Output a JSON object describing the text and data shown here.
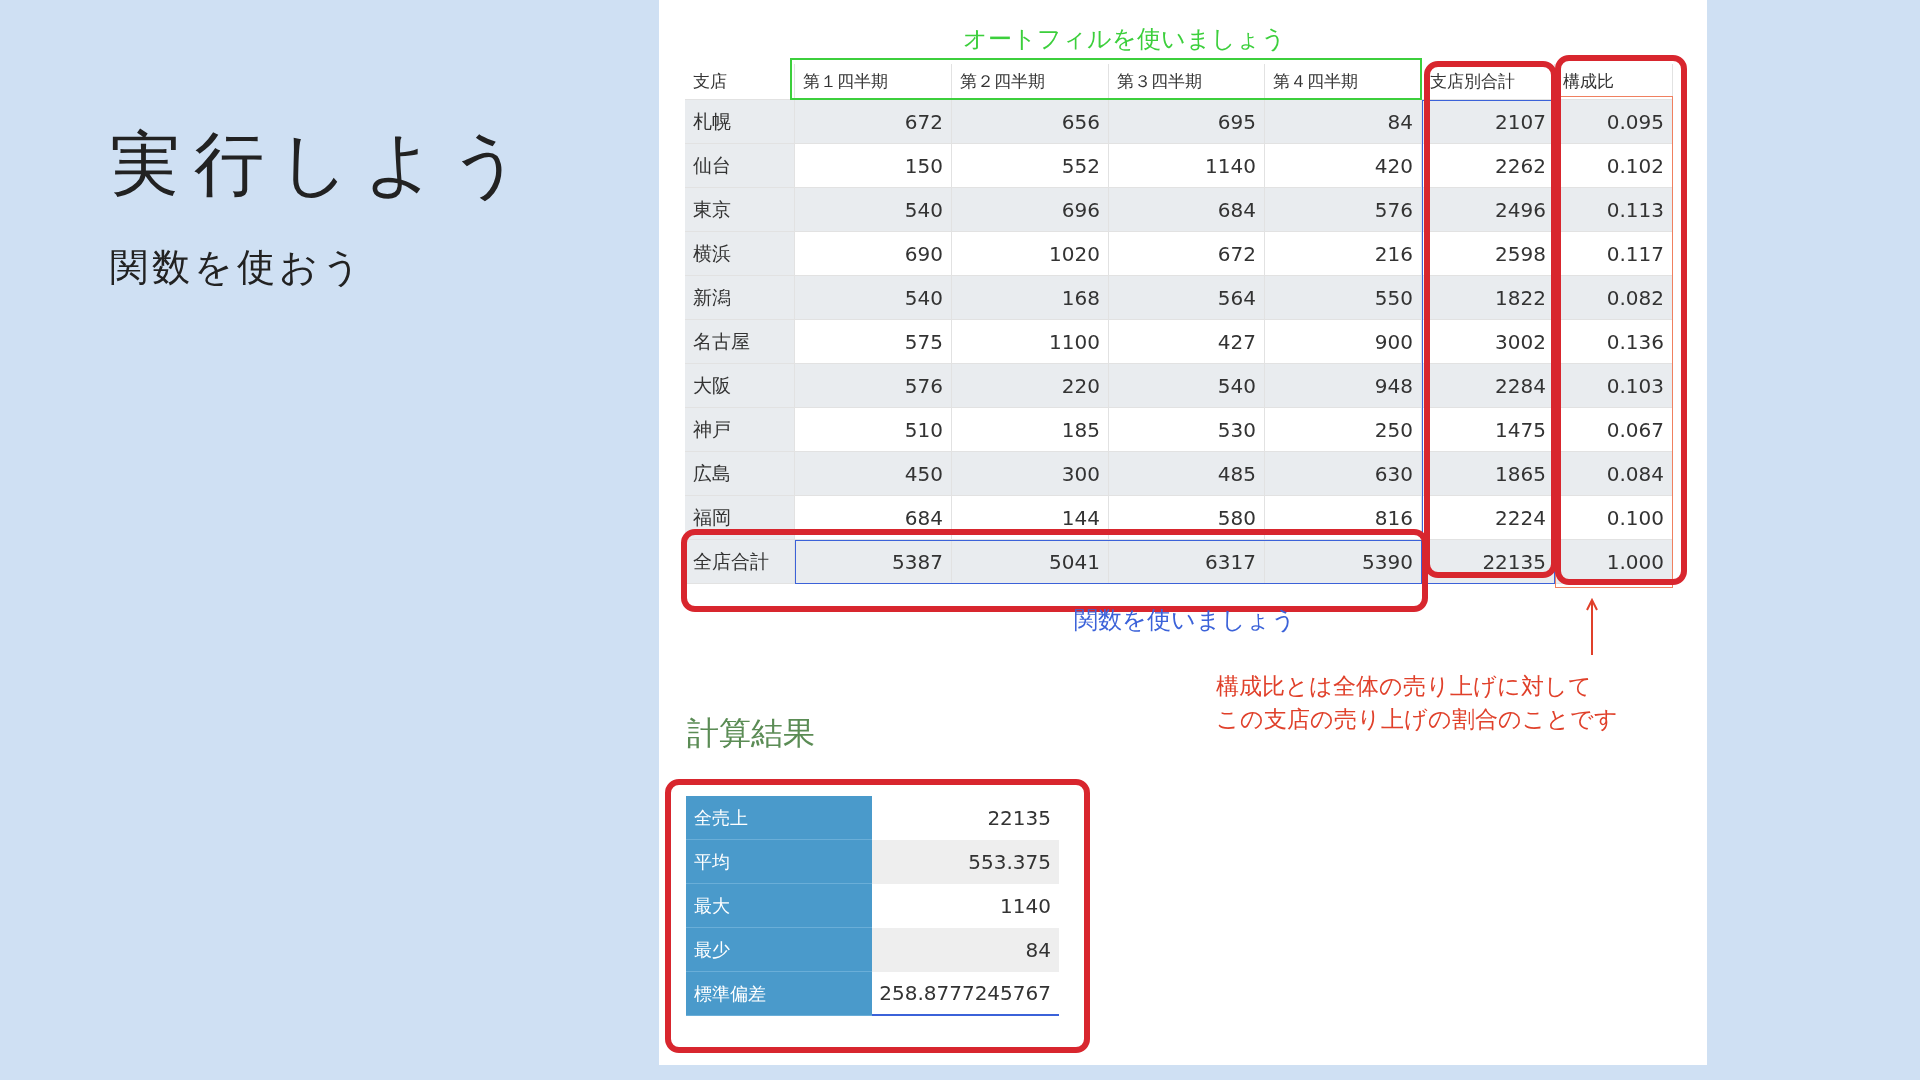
{
  "slide": {
    "title": "実行しよう",
    "subtitle": "関数を使おう"
  },
  "sheet": {
    "columns": [
      "支店",
      "第１四半期",
      "第２四半期",
      "第３四半期",
      "第４四半期",
      "支店別合計",
      "構成比"
    ],
    "rows": [
      {
        "branch": "札幌",
        "values": [
          "672",
          "656",
          "695",
          "84",
          "2107",
          "0.095"
        ]
      },
      {
        "branch": "仙台",
        "values": [
          "150",
          "552",
          "1140",
          "420",
          "2262",
          "0.102"
        ]
      },
      {
        "branch": "東京",
        "values": [
          "540",
          "696",
          "684",
          "576",
          "2496",
          "0.113"
        ]
      },
      {
        "branch": "横浜",
        "values": [
          "690",
          "1020",
          "672",
          "216",
          "2598",
          "0.117"
        ]
      },
      {
        "branch": "新潟",
        "values": [
          "540",
          "168",
          "564",
          "550",
          "1822",
          "0.082"
        ]
      },
      {
        "branch": "名古屋",
        "values": [
          "575",
          "1100",
          "427",
          "900",
          "3002",
          "0.136"
        ]
      },
      {
        "branch": "大阪",
        "values": [
          "576",
          "220",
          "540",
          "948",
          "2284",
          "0.103"
        ]
      },
      {
        "branch": "神戸",
        "values": [
          "510",
          "185",
          "530",
          "250",
          "1475",
          "0.067"
        ]
      },
      {
        "branch": "広島",
        "values": [
          "450",
          "300",
          "485",
          "630",
          "1865",
          "0.084"
        ]
      },
      {
        "branch": "福岡",
        "values": [
          "684",
          "144",
          "580",
          "816",
          "2224",
          "0.100"
        ]
      },
      {
        "branch": "全店合計",
        "values": [
          "5387",
          "5041",
          "6317",
          "5390",
          "22135",
          "1.000"
        ]
      }
    ]
  },
  "annotations": {
    "autofill_note": "オートフィルを使いましょう",
    "function_note": "関数を使いましょう",
    "ratio_note": [
      "構成比とは全体の売り上げに対して",
      "この支店の売り上げの割合のことです"
    ]
  },
  "results": {
    "heading": "計算結果",
    "rows": [
      {
        "label": "全売上",
        "value": "22135"
      },
      {
        "label": "平均",
        "value": "553.375"
      },
      {
        "label": "最大",
        "value": "1140"
      },
      {
        "label": "最少",
        "value": "84"
      },
      {
        "label": "標準偏差",
        "value": "258.8777245767"
      }
    ]
  }
}
